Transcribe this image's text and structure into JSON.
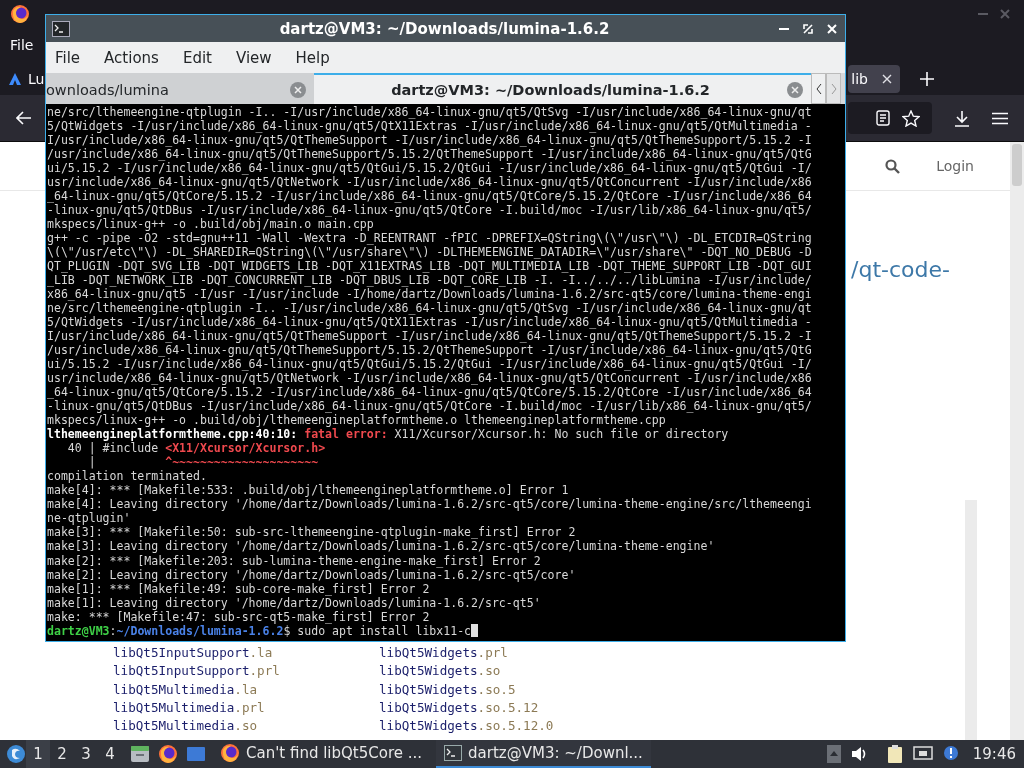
{
  "browser": {
    "menu": [
      {
        "label": "File"
      }
    ],
    "tabs": [
      {
        "label": "Lu",
        "selected": false
      },
      {
        "label": "lib",
        "selected": true
      }
    ],
    "page": {
      "login": "Login",
      "title_link": "/qt-code-",
      "listing": [
        {
          "cells": [
            [
              {
                "kind": "name",
                "text": "libQt5InputSupport"
              },
              {
                "kind": "ext",
                "text": ".la"
              }
            ],
            [
              {
                "kind": "name",
                "text": "libQt5Widgets"
              },
              {
                "kind": "ext",
                "text": ".prl"
              }
            ]
          ]
        },
        {
          "cells": [
            [
              {
                "kind": "name",
                "text": "libQt5InputSupport"
              },
              {
                "kind": "ext",
                "text": ".prl"
              }
            ],
            [
              {
                "kind": "name",
                "text": "libQt5Widgets"
              },
              {
                "kind": "ext",
                "text": ".so"
              }
            ]
          ]
        },
        {
          "cells": [
            [
              {
                "kind": "name",
                "text": "libQt5Multimedia"
              },
              {
                "kind": "ext",
                "text": ".la"
              }
            ],
            [
              {
                "kind": "name",
                "text": "libQt5Widgets"
              },
              {
                "kind": "ext",
                "text": ".so.5"
              }
            ]
          ]
        },
        {
          "cells": [
            [
              {
                "kind": "name",
                "text": "libQt5Multimedia"
              },
              {
                "kind": "ext",
                "text": ".prl"
              }
            ],
            [
              {
                "kind": "name",
                "text": "libQt5Widgets"
              },
              {
                "kind": "ext",
                "text": ".so.5.12"
              }
            ]
          ]
        },
        {
          "cells": [
            [
              {
                "kind": "name",
                "text": "libQt5Multimedia"
              },
              {
                "kind": "ext",
                "text": ".so"
              }
            ],
            [
              {
                "kind": "name",
                "text": "libQt5Widgets"
              },
              {
                "kind": "ext",
                "text": ".so.5.12.0"
              }
            ]
          ]
        }
      ]
    }
  },
  "terminal": {
    "title": "dartz@VM3: ~/Downloads/lumina-1.6.2",
    "menu": [
      {
        "label": "File"
      },
      {
        "label": "Actions"
      },
      {
        "label": "Edit"
      },
      {
        "label": "View"
      },
      {
        "label": "Help"
      }
    ],
    "tabs": [
      {
        "label": "ownloads/lumina",
        "selected": false
      },
      {
        "label": "dartz@VM3: ~/Downloads/lumina-1.6.2",
        "selected": true
      }
    ],
    "lines": [
      {
        "segments": [
          {
            "kind": "plain",
            "text": "ne/src/lthemeengine-qtplugin -I.. -I/usr/include/x86_64-linux-gnu/qt5/QtSvg -I/usr/include/x86_64-linux-gnu/qt"
          }
        ]
      },
      {
        "segments": [
          {
            "kind": "plain",
            "text": "5/QtWidgets -I/usr/include/x86_64-linux-gnu/qt5/QtX11Extras -I/usr/include/x86_64-linux-gnu/qt5/QtMultimedia -"
          }
        ]
      },
      {
        "segments": [
          {
            "kind": "plain",
            "text": "I/usr/include/x86_64-linux-gnu/qt5/QtThemeSupport -I/usr/include/x86_64-linux-gnu/qt5/QtThemeSupport/5.15.2 -I"
          }
        ]
      },
      {
        "segments": [
          {
            "kind": "plain",
            "text": "/usr/include/x86_64-linux-gnu/qt5/QtThemeSupport/5.15.2/QtThemeSupport -I/usr/include/x86_64-linux-gnu/qt5/QtG"
          }
        ]
      },
      {
        "segments": [
          {
            "kind": "plain",
            "text": "ui/5.15.2 -I/usr/include/x86_64-linux-gnu/qt5/QtGui/5.15.2/QtGui -I/usr/include/x86_64-linux-gnu/qt5/QtGui -I/"
          }
        ]
      },
      {
        "segments": [
          {
            "kind": "plain",
            "text": "usr/include/x86_64-linux-gnu/qt5/QtNetwork -I/usr/include/x86_64-linux-gnu/qt5/QtConcurrent -I/usr/include/x86"
          }
        ]
      },
      {
        "segments": [
          {
            "kind": "plain",
            "text": "_64-linux-gnu/qt5/QtCore/5.15.2 -I/usr/include/x86_64-linux-gnu/qt5/QtCore/5.15.2/QtCore -I/usr/include/x86_64"
          }
        ]
      },
      {
        "segments": [
          {
            "kind": "plain",
            "text": "-linux-gnu/qt5/QtDBus -I/usr/include/x86_64-linux-gnu/qt5/QtCore -I.build/moc -I/usr/lib/x86_64-linux-gnu/qt5/"
          }
        ]
      },
      {
        "segments": [
          {
            "kind": "plain",
            "text": "mkspecs/linux-g++ -o .build/obj/main.o main.cpp"
          }
        ]
      },
      {
        "segments": [
          {
            "kind": "plain",
            "text": "g++ -c -pipe -O2 -std=gnu++11 -Wall -Wextra -D_REENTRANT -fPIC -DPREFIX=QString\\(\\\"/usr\\\"\\) -DL_ETCDIR=QString"
          }
        ]
      },
      {
        "segments": [
          {
            "kind": "plain",
            "text": "\\(\\\"/usr/etc\\\"\\) -DL_SHAREDIR=QString\\(\\\"/usr/share\\\"\\) -DLTHEMEENGINE_DATADIR=\\\"/usr/share\\\" -DQT_NO_DEBUG -D"
          }
        ]
      },
      {
        "segments": [
          {
            "kind": "plain",
            "text": "QT_PLUGIN -DQT_SVG_LIB -DQT_WIDGETS_LIB -DQT_X11EXTRAS_LIB -DQT_MULTIMEDIA_LIB -DQT_THEME_SUPPORT_LIB -DQT_GUI"
          }
        ]
      },
      {
        "segments": [
          {
            "kind": "plain",
            "text": "_LIB -DQT_NETWORK_LIB -DQT_CONCURRENT_LIB -DQT_DBUS_LIB -DQT_CORE_LIB -I. -I../../../libLumina -I/usr/include/"
          }
        ]
      },
      {
        "segments": [
          {
            "kind": "plain",
            "text": "x86_64-linux-gnu/qt5 -I/usr -I/usr/include -I/home/dartz/Downloads/lumina-1.6.2/src-qt5/core/lumina-theme-engi"
          }
        ]
      },
      {
        "segments": [
          {
            "kind": "plain",
            "text": "ne/src/lthemeengine-qtplugin -I.. -I/usr/include/x86_64-linux-gnu/qt5/QtSvg -I/usr/include/x86_64-linux-gnu/qt"
          }
        ]
      },
      {
        "segments": [
          {
            "kind": "plain",
            "text": "5/QtWidgets -I/usr/include/x86_64-linux-gnu/qt5/QtX11Extras -I/usr/include/x86_64-linux-gnu/qt5/QtMultimedia -"
          }
        ]
      },
      {
        "segments": [
          {
            "kind": "plain",
            "text": "I/usr/include/x86_64-linux-gnu/qt5/QtThemeSupport -I/usr/include/x86_64-linux-gnu/qt5/QtThemeSupport/5.15.2 -I"
          }
        ]
      },
      {
        "segments": [
          {
            "kind": "plain",
            "text": "/usr/include/x86_64-linux-gnu/qt5/QtThemeSupport/5.15.2/QtThemeSupport -I/usr/include/x86_64-linux-gnu/qt5/QtG"
          }
        ]
      },
      {
        "segments": [
          {
            "kind": "plain",
            "text": "ui/5.15.2 -I/usr/include/x86_64-linux-gnu/qt5/QtGui/5.15.2/QtGui -I/usr/include/x86_64-linux-gnu/qt5/QtGui -I/"
          }
        ]
      },
      {
        "segments": [
          {
            "kind": "plain",
            "text": "usr/include/x86_64-linux-gnu/qt5/QtNetwork -I/usr/include/x86_64-linux-gnu/qt5/QtConcurrent -I/usr/include/x86"
          }
        ]
      },
      {
        "segments": [
          {
            "kind": "plain",
            "text": "_64-linux-gnu/qt5/QtCore/5.15.2 -I/usr/include/x86_64-linux-gnu/qt5/QtCore/5.15.2/QtCore -I/usr/include/x86_64"
          }
        ]
      },
      {
        "segments": [
          {
            "kind": "plain",
            "text": "-linux-gnu/qt5/QtDBus -I/usr/include/x86_64-linux-gnu/qt5/QtCore -I.build/moc -I/usr/lib/x86_64-linux-gnu/qt5/"
          }
        ]
      },
      {
        "segments": [
          {
            "kind": "plain",
            "text": "mkspecs/linux-g++ -o .build/obj/lthemeengineplatformtheme.o lthemeengineplatformtheme.cpp"
          }
        ]
      },
      {
        "segments": [
          {
            "kind": "bold",
            "text": "lthemeengineplatformtheme.cpp:40:10:"
          },
          {
            "kind": "error",
            "text": " fatal error:"
          },
          {
            "kind": "plain",
            "text": " X11/Xcursor/Xcursor.h: No such file or directory"
          }
        ]
      },
      {
        "segments": [
          {
            "kind": "plain",
            "text": "   40 | #include "
          },
          {
            "kind": "error",
            "text": "<X11/Xcursor/Xcursor.h>"
          }
        ]
      },
      {
        "segments": [
          {
            "kind": "plain",
            "text": "      |          "
          },
          {
            "kind": "error",
            "text": "^~~~~~~~~~~~~~~~~~~~~~"
          }
        ]
      },
      {
        "segments": [
          {
            "kind": "plain",
            "text": "compilation terminated."
          }
        ]
      },
      {
        "segments": [
          {
            "kind": "plain",
            "text": "make[4]: *** [Makefile:533: .build/obj/lthemeengineplatformtheme.o] Error 1"
          }
        ]
      },
      {
        "segments": [
          {
            "kind": "plain",
            "text": "make[4]: Leaving directory '/home/dartz/Downloads/lumina-1.6.2/src-qt5/core/lumina-theme-engine/src/lthemeengi"
          }
        ]
      },
      {
        "segments": [
          {
            "kind": "plain",
            "text": "ne-qtplugin'"
          }
        ]
      },
      {
        "segments": [
          {
            "kind": "plain",
            "text": "make[3]: *** [Makefile:50: sub-src-lthemeengine-qtplugin-make_first] Error 2"
          }
        ]
      },
      {
        "segments": [
          {
            "kind": "plain",
            "text": "make[3]: Leaving directory '/home/dartz/Downloads/lumina-1.6.2/src-qt5/core/lumina-theme-engine'"
          }
        ]
      },
      {
        "segments": [
          {
            "kind": "plain",
            "text": "make[2]: *** [Makefile:203: sub-lumina-theme-engine-make_first] Error 2"
          }
        ]
      },
      {
        "segments": [
          {
            "kind": "plain",
            "text": "make[2]: Leaving directory '/home/dartz/Downloads/lumina-1.6.2/src-qt5/core'"
          }
        ]
      },
      {
        "segments": [
          {
            "kind": "plain",
            "text": "make[1]: *** [Makefile:49: sub-core-make_first] Error 2"
          }
        ]
      },
      {
        "segments": [
          {
            "kind": "plain",
            "text": "make[1]: Leaving directory '/home/dartz/Downloads/lumina-1.6.2/src-qt5'"
          }
        ]
      },
      {
        "segments": [
          {
            "kind": "plain",
            "text": "make: *** [Makefile:47: sub-src-qt5-make_first] Error 2"
          }
        ]
      },
      {
        "segments": [
          {
            "kind": "user",
            "text": "dartz@VM3"
          },
          {
            "kind": "plain",
            "text": ":"
          },
          {
            "kind": "path",
            "text": "~/Downloads/lumina-1.6.2"
          },
          {
            "kind": "plain",
            "text": "$ sudo apt install libx11-c"
          }
        ]
      }
    ]
  },
  "taskbar": {
    "workspaces": [
      {
        "label": "1",
        "selected": true
      },
      {
        "label": "2",
        "selected": false
      },
      {
        "label": "3",
        "selected": false
      },
      {
        "label": "4",
        "selected": false
      }
    ],
    "tasks": [
      {
        "kind": "browser",
        "label": "Can't find libQt5Core ...",
        "selected": false
      },
      {
        "kind": "terminal",
        "label": "dartz@VM3: ~/Downl...",
        "selected": true
      }
    ],
    "clock": "19:46"
  }
}
